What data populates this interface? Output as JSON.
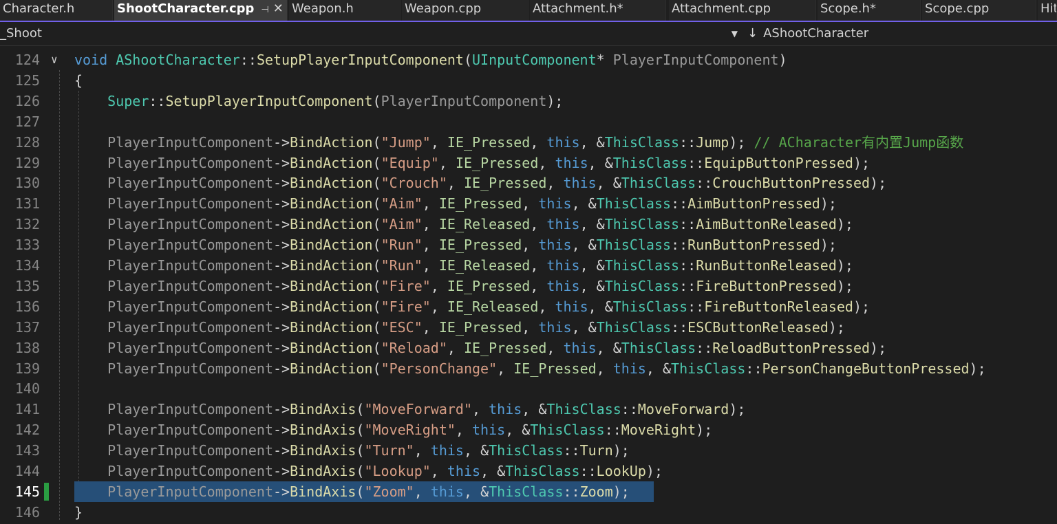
{
  "tabs": [
    {
      "label": "Character.h"
    },
    {
      "label": "ShootCharacter.cpp",
      "active": true,
      "pin": "⊣",
      "close": "✕"
    },
    {
      "label": "Weapon.h"
    },
    {
      "label": "Weapon.cpp"
    },
    {
      "label": "Attachment.h*"
    },
    {
      "label": "Attachment.cpp"
    },
    {
      "label": "Scope.h*"
    },
    {
      "label": "Scope.cpp"
    },
    {
      "label": "Hit"
    }
  ],
  "navigation": {
    "scope_value": "_Shoot",
    "member_value": "AShootCharacter",
    "member_icon": "arrow-down-icon"
  },
  "editor": {
    "current_line": "145",
    "lines": [
      {
        "num": "124",
        "tokens": [
          [
            "kw",
            "void "
          ],
          [
            "ty",
            "AShootCharacter"
          ],
          [
            "pl",
            "::"
          ],
          [
            "fn",
            "SetupPlayerInputComponent"
          ],
          [
            "pl",
            "("
          ],
          [
            "ty",
            "UInputComponent"
          ],
          [
            "pl",
            "* "
          ],
          [
            "var",
            "PlayerInputComponent"
          ],
          [
            "pl",
            ")"
          ]
        ]
      },
      {
        "num": "125",
        "tokens": [
          [
            "pl",
            "{"
          ]
        ]
      },
      {
        "num": "126",
        "tokens": [
          [
            "pl",
            "    "
          ],
          [
            "ty",
            "Super"
          ],
          [
            "pl",
            "::"
          ],
          [
            "fn",
            "SetupPlayerInputComponent"
          ],
          [
            "pl",
            "("
          ],
          [
            "var",
            "PlayerInputComponent"
          ],
          [
            "pl",
            ");"
          ]
        ]
      },
      {
        "num": "127",
        "tokens": []
      },
      {
        "num": "128",
        "tokens": [
          [
            "pl",
            "    "
          ],
          [
            "var",
            "PlayerInputComponent"
          ],
          [
            "pl",
            "->"
          ],
          [
            "fn",
            "BindAction"
          ],
          [
            "pl",
            "("
          ],
          [
            "str",
            "\"Jump\""
          ],
          [
            "pl",
            ", "
          ],
          [
            "en",
            "IE_Pressed"
          ],
          [
            "pl",
            ", "
          ],
          [
            "kw",
            "this"
          ],
          [
            "pl",
            ", &"
          ],
          [
            "ty",
            "ThisClass"
          ],
          [
            "pl",
            "::"
          ],
          [
            "fn",
            "Jump"
          ],
          [
            "pl",
            ");"
          ],
          [
            "cm",
            " // ACharacter有内置Jump函数"
          ]
        ]
      },
      {
        "num": "129",
        "tokens": [
          [
            "pl",
            "    "
          ],
          [
            "var",
            "PlayerInputComponent"
          ],
          [
            "pl",
            "->"
          ],
          [
            "fn",
            "BindAction"
          ],
          [
            "pl",
            "("
          ],
          [
            "str",
            "\"Equip\""
          ],
          [
            "pl",
            ", "
          ],
          [
            "en",
            "IE_Pressed"
          ],
          [
            "pl",
            ", "
          ],
          [
            "kw",
            "this"
          ],
          [
            "pl",
            ", &"
          ],
          [
            "ty",
            "ThisClass"
          ],
          [
            "pl",
            "::"
          ],
          [
            "fn",
            "EquipButtonPressed"
          ],
          [
            "pl",
            ");"
          ]
        ]
      },
      {
        "num": "130",
        "tokens": [
          [
            "pl",
            "    "
          ],
          [
            "var",
            "PlayerInputComponent"
          ],
          [
            "pl",
            "->"
          ],
          [
            "fn",
            "BindAction"
          ],
          [
            "pl",
            "("
          ],
          [
            "str",
            "\"Crouch\""
          ],
          [
            "pl",
            ", "
          ],
          [
            "en",
            "IE_Pressed"
          ],
          [
            "pl",
            ", "
          ],
          [
            "kw",
            "this"
          ],
          [
            "pl",
            ", &"
          ],
          [
            "ty",
            "ThisClass"
          ],
          [
            "pl",
            "::"
          ],
          [
            "fn",
            "CrouchButtonPressed"
          ],
          [
            "pl",
            ");"
          ]
        ]
      },
      {
        "num": "131",
        "tokens": [
          [
            "pl",
            "    "
          ],
          [
            "var",
            "PlayerInputComponent"
          ],
          [
            "pl",
            "->"
          ],
          [
            "fn",
            "BindAction"
          ],
          [
            "pl",
            "("
          ],
          [
            "str",
            "\"Aim\""
          ],
          [
            "pl",
            ", "
          ],
          [
            "en",
            "IE_Pressed"
          ],
          [
            "pl",
            ", "
          ],
          [
            "kw",
            "this"
          ],
          [
            "pl",
            ", &"
          ],
          [
            "ty",
            "ThisClass"
          ],
          [
            "pl",
            "::"
          ],
          [
            "fn",
            "AimButtonPressed"
          ],
          [
            "pl",
            ");"
          ]
        ]
      },
      {
        "num": "132",
        "tokens": [
          [
            "pl",
            "    "
          ],
          [
            "var",
            "PlayerInputComponent"
          ],
          [
            "pl",
            "->"
          ],
          [
            "fn",
            "BindAction"
          ],
          [
            "pl",
            "("
          ],
          [
            "str",
            "\"Aim\""
          ],
          [
            "pl",
            ", "
          ],
          [
            "en",
            "IE_Released"
          ],
          [
            "pl",
            ", "
          ],
          [
            "kw",
            "this"
          ],
          [
            "pl",
            ", &"
          ],
          [
            "ty",
            "ThisClass"
          ],
          [
            "pl",
            "::"
          ],
          [
            "fn",
            "AimButtonReleased"
          ],
          [
            "pl",
            ");"
          ]
        ]
      },
      {
        "num": "133",
        "tokens": [
          [
            "pl",
            "    "
          ],
          [
            "var",
            "PlayerInputComponent"
          ],
          [
            "pl",
            "->"
          ],
          [
            "fn",
            "BindAction"
          ],
          [
            "pl",
            "("
          ],
          [
            "str",
            "\"Run\""
          ],
          [
            "pl",
            ", "
          ],
          [
            "en",
            "IE_Pressed"
          ],
          [
            "pl",
            ", "
          ],
          [
            "kw",
            "this"
          ],
          [
            "pl",
            ", &"
          ],
          [
            "ty",
            "ThisClass"
          ],
          [
            "pl",
            "::"
          ],
          [
            "fn",
            "RunButtonPressed"
          ],
          [
            "pl",
            ");"
          ]
        ]
      },
      {
        "num": "134",
        "tokens": [
          [
            "pl",
            "    "
          ],
          [
            "var",
            "PlayerInputComponent"
          ],
          [
            "pl",
            "->"
          ],
          [
            "fn",
            "BindAction"
          ],
          [
            "pl",
            "("
          ],
          [
            "str",
            "\"Run\""
          ],
          [
            "pl",
            ", "
          ],
          [
            "en",
            "IE_Released"
          ],
          [
            "pl",
            ", "
          ],
          [
            "kw",
            "this"
          ],
          [
            "pl",
            ", &"
          ],
          [
            "ty",
            "ThisClass"
          ],
          [
            "pl",
            "::"
          ],
          [
            "fn",
            "RunButtonReleased"
          ],
          [
            "pl",
            ");"
          ]
        ]
      },
      {
        "num": "135",
        "tokens": [
          [
            "pl",
            "    "
          ],
          [
            "var",
            "PlayerInputComponent"
          ],
          [
            "pl",
            "->"
          ],
          [
            "fn",
            "BindAction"
          ],
          [
            "pl",
            "("
          ],
          [
            "str",
            "\"Fire\""
          ],
          [
            "pl",
            ", "
          ],
          [
            "en",
            "IE_Pressed"
          ],
          [
            "pl",
            ", "
          ],
          [
            "kw",
            "this"
          ],
          [
            "pl",
            ", &"
          ],
          [
            "ty",
            "ThisClass"
          ],
          [
            "pl",
            "::"
          ],
          [
            "fn",
            "FireButtonPressed"
          ],
          [
            "pl",
            ");"
          ]
        ]
      },
      {
        "num": "136",
        "tokens": [
          [
            "pl",
            "    "
          ],
          [
            "var",
            "PlayerInputComponent"
          ],
          [
            "pl",
            "->"
          ],
          [
            "fn",
            "BindAction"
          ],
          [
            "pl",
            "("
          ],
          [
            "str",
            "\"Fire\""
          ],
          [
            "pl",
            ", "
          ],
          [
            "en",
            "IE_Released"
          ],
          [
            "pl",
            ", "
          ],
          [
            "kw",
            "this"
          ],
          [
            "pl",
            ", &"
          ],
          [
            "ty",
            "ThisClass"
          ],
          [
            "pl",
            "::"
          ],
          [
            "fn",
            "FireButtonReleased"
          ],
          [
            "pl",
            ");"
          ]
        ]
      },
      {
        "num": "137",
        "tokens": [
          [
            "pl",
            "    "
          ],
          [
            "var",
            "PlayerInputComponent"
          ],
          [
            "pl",
            "->"
          ],
          [
            "fn",
            "BindAction"
          ],
          [
            "pl",
            "("
          ],
          [
            "str",
            "\"ESC\""
          ],
          [
            "pl",
            ", "
          ],
          [
            "en",
            "IE_Pressed"
          ],
          [
            "pl",
            ", "
          ],
          [
            "kw",
            "this"
          ],
          [
            "pl",
            ", &"
          ],
          [
            "ty",
            "ThisClass"
          ],
          [
            "pl",
            "::"
          ],
          [
            "fn",
            "ESCButtonReleased"
          ],
          [
            "pl",
            ");"
          ]
        ]
      },
      {
        "num": "138",
        "tokens": [
          [
            "pl",
            "    "
          ],
          [
            "var",
            "PlayerInputComponent"
          ],
          [
            "pl",
            "->"
          ],
          [
            "fn",
            "BindAction"
          ],
          [
            "pl",
            "("
          ],
          [
            "str",
            "\"Reload\""
          ],
          [
            "pl",
            ", "
          ],
          [
            "en",
            "IE_Pressed"
          ],
          [
            "pl",
            ", "
          ],
          [
            "kw",
            "this"
          ],
          [
            "pl",
            ", &"
          ],
          [
            "ty",
            "ThisClass"
          ],
          [
            "pl",
            "::"
          ],
          [
            "fn",
            "ReloadButtonPressed"
          ],
          [
            "pl",
            ");"
          ]
        ]
      },
      {
        "num": "139",
        "tokens": [
          [
            "pl",
            "    "
          ],
          [
            "var",
            "PlayerInputComponent"
          ],
          [
            "pl",
            "->"
          ],
          [
            "fn",
            "BindAction"
          ],
          [
            "pl",
            "("
          ],
          [
            "str",
            "\"PersonChange\""
          ],
          [
            "pl",
            ", "
          ],
          [
            "en",
            "IE_Pressed"
          ],
          [
            "pl",
            ", "
          ],
          [
            "kw",
            "this"
          ],
          [
            "pl",
            ", &"
          ],
          [
            "ty",
            "ThisClass"
          ],
          [
            "pl",
            "::"
          ],
          [
            "fn",
            "PersonChangeButtonPressed"
          ],
          [
            "pl",
            ");"
          ]
        ]
      },
      {
        "num": "140",
        "tokens": []
      },
      {
        "num": "141",
        "tokens": [
          [
            "pl",
            "    "
          ],
          [
            "var",
            "PlayerInputComponent"
          ],
          [
            "pl",
            "->"
          ],
          [
            "fn",
            "BindAxis"
          ],
          [
            "pl",
            "("
          ],
          [
            "str",
            "\"MoveForward\""
          ],
          [
            "pl",
            ", "
          ],
          [
            "kw",
            "this"
          ],
          [
            "pl",
            ", &"
          ],
          [
            "ty",
            "ThisClass"
          ],
          [
            "pl",
            "::"
          ],
          [
            "fn",
            "MoveForward"
          ],
          [
            "pl",
            ");"
          ]
        ]
      },
      {
        "num": "142",
        "tokens": [
          [
            "pl",
            "    "
          ],
          [
            "var",
            "PlayerInputComponent"
          ],
          [
            "pl",
            "->"
          ],
          [
            "fn",
            "BindAxis"
          ],
          [
            "pl",
            "("
          ],
          [
            "str",
            "\"MoveRight\""
          ],
          [
            "pl",
            ", "
          ],
          [
            "kw",
            "this"
          ],
          [
            "pl",
            ", &"
          ],
          [
            "ty",
            "ThisClass"
          ],
          [
            "pl",
            "::"
          ],
          [
            "fn",
            "MoveRight"
          ],
          [
            "pl",
            ");"
          ]
        ]
      },
      {
        "num": "143",
        "tokens": [
          [
            "pl",
            "    "
          ],
          [
            "var",
            "PlayerInputComponent"
          ],
          [
            "pl",
            "->"
          ],
          [
            "fn",
            "BindAxis"
          ],
          [
            "pl",
            "("
          ],
          [
            "str",
            "\"Turn\""
          ],
          [
            "pl",
            ", "
          ],
          [
            "kw",
            "this"
          ],
          [
            "pl",
            ", &"
          ],
          [
            "ty",
            "ThisClass"
          ],
          [
            "pl",
            "::"
          ],
          [
            "fn",
            "Turn"
          ],
          [
            "pl",
            ");"
          ]
        ]
      },
      {
        "num": "144",
        "tokens": [
          [
            "pl",
            "    "
          ],
          [
            "var",
            "PlayerInputComponent"
          ],
          [
            "pl",
            "->"
          ],
          [
            "fn",
            "BindAxis"
          ],
          [
            "pl",
            "("
          ],
          [
            "str",
            "\"Lookup\""
          ],
          [
            "pl",
            ", "
          ],
          [
            "kw",
            "this"
          ],
          [
            "pl",
            ", &"
          ],
          [
            "ty",
            "ThisClass"
          ],
          [
            "pl",
            "::"
          ],
          [
            "fn",
            "LookUp"
          ],
          [
            "pl",
            ");"
          ]
        ]
      },
      {
        "num": "145",
        "tokens": [
          [
            "pl",
            "    "
          ],
          [
            "var",
            "PlayerInputComponent"
          ],
          [
            "pl",
            "->"
          ],
          [
            "fn",
            "BindAxis"
          ],
          [
            "pl",
            "("
          ],
          [
            "str",
            "\"Zoom\""
          ],
          [
            "pl",
            ", "
          ],
          [
            "kw",
            "this"
          ],
          [
            "pl",
            ", &"
          ],
          [
            "ty",
            "ThisClass"
          ],
          [
            "pl",
            "::"
          ],
          [
            "fn",
            "Zoom"
          ],
          [
            "pl",
            ");"
          ]
        ]
      },
      {
        "num": "146",
        "tokens": [
          [
            "pl",
            "}"
          ]
        ]
      }
    ]
  }
}
